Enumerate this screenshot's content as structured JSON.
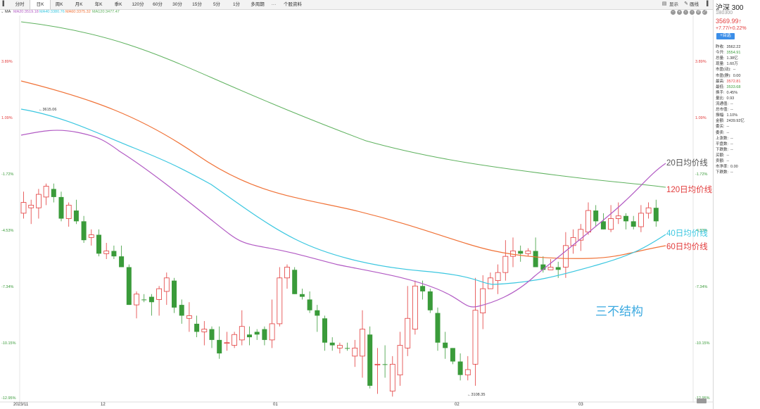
{
  "toolbar": {
    "tabs": [
      "分时",
      "日K",
      "周K",
      "月K",
      "年K",
      "季K",
      "120分",
      "60分",
      "30分",
      "15分",
      "5分",
      "1分",
      "多周期",
      "···",
      "个股资料"
    ],
    "active_index": 1,
    "right_items": [
      "显示",
      "画线"
    ]
  },
  "ma_legend": [
    {
      "label": "MA20:3519.18",
      "color": "#b25bc4"
    },
    {
      "label": "MA40:3380.76",
      "color": "#3bc7e0"
    },
    {
      "label": "MA60:3375.32",
      "color": "#f07237"
    },
    {
      "label": "MA120:3477.47",
      "color": "#5fb25f"
    }
  ],
  "ma_prefix": "MA",
  "panel": {
    "name": "沪深 300",
    "code": "1B0300",
    "price": "3569.99↑",
    "change": "+7.77/+0.22%",
    "watch_btn": "+自选",
    "rows": [
      {
        "k": "昨收:",
        "v": "3562.22",
        "c": "#333"
      },
      {
        "k": "今开:",
        "v": "3554.91",
        "c": "#3a9b3a"
      },
      {
        "k": "总量:",
        "v": "1.38亿",
        "c": "#333"
      },
      {
        "k": "现量:",
        "v": "1.60万",
        "c": "#333"
      },
      {
        "k": "市盈(动):",
        "v": "--",
        "c": "#333"
      },
      {
        "k": "市盈(静):",
        "v": "0.00",
        "c": "#333"
      },
      {
        "k": "最高:",
        "v": "3572.81",
        "c": "#e23b3b"
      },
      {
        "k": "最低:",
        "v": "3533.68",
        "c": "#3a9b3a"
      },
      {
        "k": "换手:",
        "v": "0.45%",
        "c": "#333"
      },
      {
        "k": "量比:",
        "v": "0.93",
        "c": "#333"
      },
      {
        "k": "流通值:",
        "v": "--",
        "c": "#333"
      },
      {
        "k": "总市值:",
        "v": "--",
        "c": "#333"
      },
      {
        "k": "振幅:",
        "v": "1.10%",
        "c": "#333"
      },
      {
        "k": "金额:",
        "v": "2439.92亿",
        "c": "#333"
      },
      {
        "k": "委买:",
        "v": "--",
        "c": "#333"
      },
      {
        "k": "委卖:",
        "v": "--",
        "c": "#333"
      },
      {
        "k": "上涨数:",
        "v": "--",
        "c": "#333"
      },
      {
        "k": "平盘数:",
        "v": "--",
        "c": "#333"
      },
      {
        "k": "下跌数:",
        "v": "--",
        "c": "#333"
      },
      {
        "k": "买额:",
        "v": "--",
        "c": "#333"
      },
      {
        "k": "卖额:",
        "v": "--",
        "c": "#333"
      },
      {
        "k": "市净率:",
        "v": "0.00",
        "c": "#333"
      },
      {
        "k": "下跌数:",
        "v": "--",
        "c": "#333"
      }
    ]
  },
  "chart_data": {
    "type": "candlestick",
    "y_pct_ticks": [
      "3.89%",
      "1.09%",
      "-1.72%",
      "-4.53%",
      "-7.34%",
      "-10.15%",
      "-12.95%"
    ],
    "y_pct_colors": [
      "#e23b3b",
      "#e23b3b",
      "#3a9b3a",
      "#3a9b3a",
      "#3a9b3a",
      "#3a9b3a",
      "#3a9b3a"
    ],
    "x_ticks": [
      "2023/11",
      "12",
      "01",
      "02",
      "03"
    ],
    "high_label": "←3615.06",
    "low_label": "←3108.35",
    "up_color": "#e23b3b",
    "down_color": "#3a9b3a",
    "candles": [
      [
        0.36,
        0.32,
        0.38,
        0.28,
        1
      ],
      [
        0.34,
        0.33,
        0.4,
        0.31,
        1
      ],
      [
        0.34,
        0.29,
        0.38,
        0.27,
        1
      ],
      [
        0.3,
        0.26,
        0.33,
        0.25,
        1
      ],
      [
        0.27,
        0.3,
        0.32,
        0.25,
        0
      ],
      [
        0.3,
        0.38,
        0.39,
        0.28,
        0
      ],
      [
        0.38,
        0.33,
        0.41,
        0.32,
        1
      ],
      [
        0.35,
        0.39,
        0.4,
        0.31,
        0
      ],
      [
        0.39,
        0.46,
        0.47,
        0.37,
        0
      ],
      [
        0.45,
        0.44,
        0.48,
        0.42,
        1
      ],
      [
        0.44,
        0.51,
        0.52,
        0.42,
        0
      ],
      [
        0.51,
        0.5,
        0.53,
        0.47,
        1
      ],
      [
        0.5,
        0.52,
        0.53,
        0.48,
        0
      ],
      [
        0.52,
        0.56,
        0.56,
        0.48,
        0
      ],
      [
        0.56,
        0.7,
        0.7,
        0.55,
        0
      ],
      [
        0.7,
        0.66,
        0.75,
        0.65,
        1
      ],
      [
        0.68,
        0.68,
        0.69,
        0.66,
        0
      ],
      [
        0.67,
        0.69,
        0.74,
        0.66,
        0
      ],
      [
        0.68,
        0.64,
        0.74,
        0.63,
        1
      ],
      [
        0.65,
        0.6,
        0.7,
        0.58,
        1
      ],
      [
        0.61,
        0.71,
        0.73,
        0.6,
        0
      ],
      [
        0.7,
        0.74,
        0.77,
        0.68,
        0
      ],
      [
        0.74,
        0.75,
        0.8,
        0.69,
        1
      ],
      [
        0.77,
        0.8,
        0.82,
        0.74,
        0
      ],
      [
        0.8,
        0.79,
        0.85,
        0.76,
        1
      ],
      [
        0.79,
        0.83,
        0.86,
        0.78,
        0
      ],
      [
        0.83,
        0.88,
        0.9,
        0.78,
        0
      ],
      [
        0.84,
        0.84,
        0.87,
        0.8,
        1
      ],
      [
        0.85,
        0.81,
        0.86,
        0.8,
        1
      ],
      [
        0.83,
        0.78,
        0.85,
        0.72,
        1
      ],
      [
        0.82,
        0.81,
        0.85,
        0.78,
        0
      ],
      [
        0.8,
        0.81,
        0.83,
        0.79,
        0
      ],
      [
        0.79,
        0.83,
        0.85,
        0.78,
        0
      ],
      [
        0.83,
        0.77,
        0.86,
        0.68,
        1
      ],
      [
        0.77,
        0.6,
        0.78,
        0.56,
        1
      ],
      [
        0.6,
        0.56,
        0.64,
        0.55,
        1
      ],
      [
        0.57,
        0.66,
        0.66,
        0.56,
        0
      ],
      [
        0.66,
        0.67,
        0.68,
        0.64,
        0
      ],
      [
        0.68,
        0.72,
        0.73,
        0.65,
        0
      ],
      [
        0.72,
        0.74,
        0.8,
        0.7,
        0
      ],
      [
        0.75,
        0.84,
        0.87,
        0.74,
        0
      ],
      [
        0.84,
        0.85,
        0.87,
        0.82,
        0
      ],
      [
        0.85,
        0.86,
        0.88,
        0.84,
        1
      ],
      [
        0.86,
        0.86,
        0.87,
        0.84,
        0
      ],
      [
        0.86,
        0.89,
        0.93,
        0.83,
        1
      ],
      [
        0.89,
        0.79,
        0.97,
        0.72,
        1
      ],
      [
        0.81,
        1.0,
        1.01,
        0.78,
        0
      ],
      [
        0.92,
        0.92,
        1.03,
        0.86,
        1
      ],
      [
        0.92,
        0.92,
        0.97,
        0.85,
        0
      ],
      [
        0.92,
        1.02,
        1.04,
        0.89,
        1
      ],
      [
        0.96,
        0.85,
        1.0,
        0.8,
        1
      ],
      [
        0.86,
        0.75,
        0.89,
        0.63,
        1
      ],
      [
        0.79,
        0.63,
        0.81,
        0.61,
        1
      ],
      [
        0.63,
        0.65,
        0.68,
        0.61,
        0
      ],
      [
        0.65,
        0.72,
        0.73,
        0.64,
        0
      ],
      [
        0.73,
        0.84,
        0.87,
        0.71,
        0
      ],
      [
        0.84,
        0.86,
        0.9,
        0.8,
        0
      ],
      [
        0.86,
        0.91,
        0.92,
        0.86,
        0
      ],
      [
        0.91,
        0.96,
        0.98,
        0.88,
        0
      ],
      [
        0.96,
        0.94,
        0.98,
        0.89,
        1
      ],
      [
        0.92,
        0.72,
        1.0,
        0.6,
        1
      ],
      [
        0.73,
        0.64,
        0.79,
        0.59,
        1
      ],
      [
        0.64,
        0.6,
        0.64,
        0.58,
        1
      ],
      [
        0.61,
        0.58,
        0.66,
        0.55,
        1
      ],
      [
        0.58,
        0.52,
        0.61,
        0.46,
        1
      ],
      [
        0.52,
        0.5,
        0.56,
        0.45,
        1
      ],
      [
        0.5,
        0.51,
        0.54,
        0.48,
        0
      ],
      [
        0.51,
        0.5,
        0.52,
        0.49,
        1
      ],
      [
        0.5,
        0.56,
        0.56,
        0.45,
        0
      ],
      [
        0.55,
        0.57,
        0.58,
        0.52,
        0
      ],
      [
        0.57,
        0.56,
        0.57,
        0.53,
        1
      ],
      [
        0.56,
        0.57,
        0.6,
        0.54,
        0
      ],
      [
        0.56,
        0.48,
        0.6,
        0.43,
        1
      ],
      [
        0.48,
        0.45,
        0.51,
        0.42,
        1
      ],
      [
        0.46,
        0.42,
        0.5,
        0.4,
        1
      ],
      [
        0.43,
        0.35,
        0.44,
        0.32,
        1
      ],
      [
        0.35,
        0.39,
        0.41,
        0.33,
        0
      ],
      [
        0.39,
        0.42,
        0.42,
        0.36,
        0
      ],
      [
        0.42,
        0.38,
        0.43,
        0.33,
        1
      ],
      [
        0.38,
        0.37,
        0.4,
        0.32,
        1
      ],
      [
        0.37,
        0.39,
        0.42,
        0.36,
        0
      ],
      [
        0.39,
        0.41,
        0.42,
        0.37,
        0
      ],
      [
        0.41,
        0.36,
        0.43,
        0.33,
        1
      ],
      [
        0.36,
        0.34,
        0.38,
        0.32,
        1
      ],
      [
        0.34,
        0.39,
        0.41,
        0.31,
        0
      ]
    ]
  }
}
